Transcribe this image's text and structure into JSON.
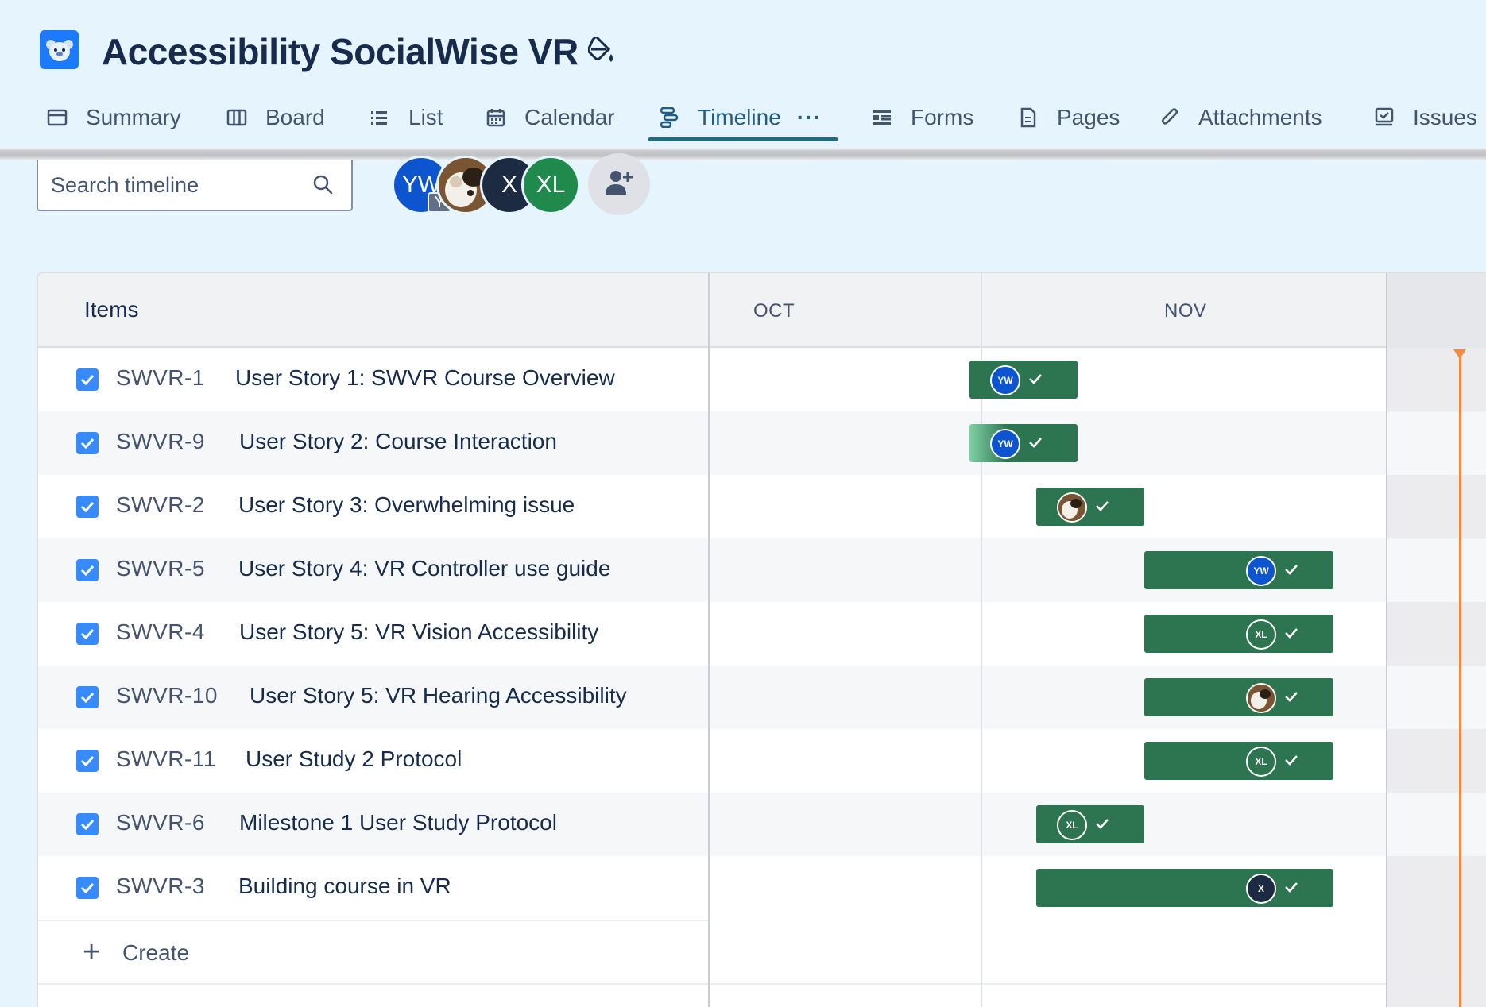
{
  "project": {
    "title": "Accessibility SocialWise VR",
    "icon": "koala-project-icon"
  },
  "tabs": [
    {
      "label": "Summary",
      "icon": "summary-icon"
    },
    {
      "label": "Board",
      "icon": "board-icon"
    },
    {
      "label": "List",
      "icon": "list-icon"
    },
    {
      "label": "Calendar",
      "icon": "calendar-icon"
    },
    {
      "label": "Timeline",
      "icon": "timeline-icon",
      "active": true
    },
    {
      "label": "Forms",
      "icon": "forms-icon"
    },
    {
      "label": "Pages",
      "icon": "pages-icon"
    },
    {
      "label": "Attachments",
      "icon": "attachment-icon"
    },
    {
      "label": "Issues",
      "icon": "issues-icon"
    }
  ],
  "more_label": "···",
  "toolbar": {
    "search_placeholder": "Search timeline",
    "avatars": [
      {
        "initials": "YW",
        "badge": "Y",
        "color": "#0c55cf"
      },
      {
        "initials": "",
        "type": "photo"
      },
      {
        "initials": "X",
        "color": "#1c2b41"
      },
      {
        "initials": "XL",
        "color": "#1f8a4c"
      }
    ]
  },
  "timeline": {
    "items_header": "Items",
    "months": [
      "OCT",
      "NOV"
    ],
    "create_label": "Create",
    "colors": {
      "bar": "#2d7451",
      "today": "#f38a3f",
      "checkbox": "#388bff"
    },
    "rows": [
      {
        "key": "SWVR-1",
        "summary": "User Story 1: SWVR Course Overview",
        "assignee": "YW",
        "done": true
      },
      {
        "key": "SWVR-9",
        "summary": "User Story 2: Course Interaction",
        "assignee": "YW",
        "done": true
      },
      {
        "key": "SWVR-2",
        "summary": "User Story 3: Overwhelming issue",
        "assignee": "photo",
        "done": true
      },
      {
        "key": "SWVR-5",
        "summary": "User Story 4: VR Controller use guide",
        "assignee": "YW",
        "done": true
      },
      {
        "key": "SWVR-4",
        "summary": "User Story 5: VR Vision Accessibility",
        "assignee": "XL",
        "done": true
      },
      {
        "key": "SWVR-10",
        "summary": "User Story 5: VR Hearing Accessibility",
        "assignee": "photo",
        "done": true
      },
      {
        "key": "SWVR-11",
        "summary": "User Study 2 Protocol",
        "assignee": "XL",
        "done": true
      },
      {
        "key": "SWVR-6",
        "summary": "Milestone 1 User Study Protocol",
        "assignee": "XL",
        "done": true
      },
      {
        "key": "SWVR-3",
        "summary": "Building course in VR",
        "assignee": "X",
        "done": true
      }
    ]
  }
}
